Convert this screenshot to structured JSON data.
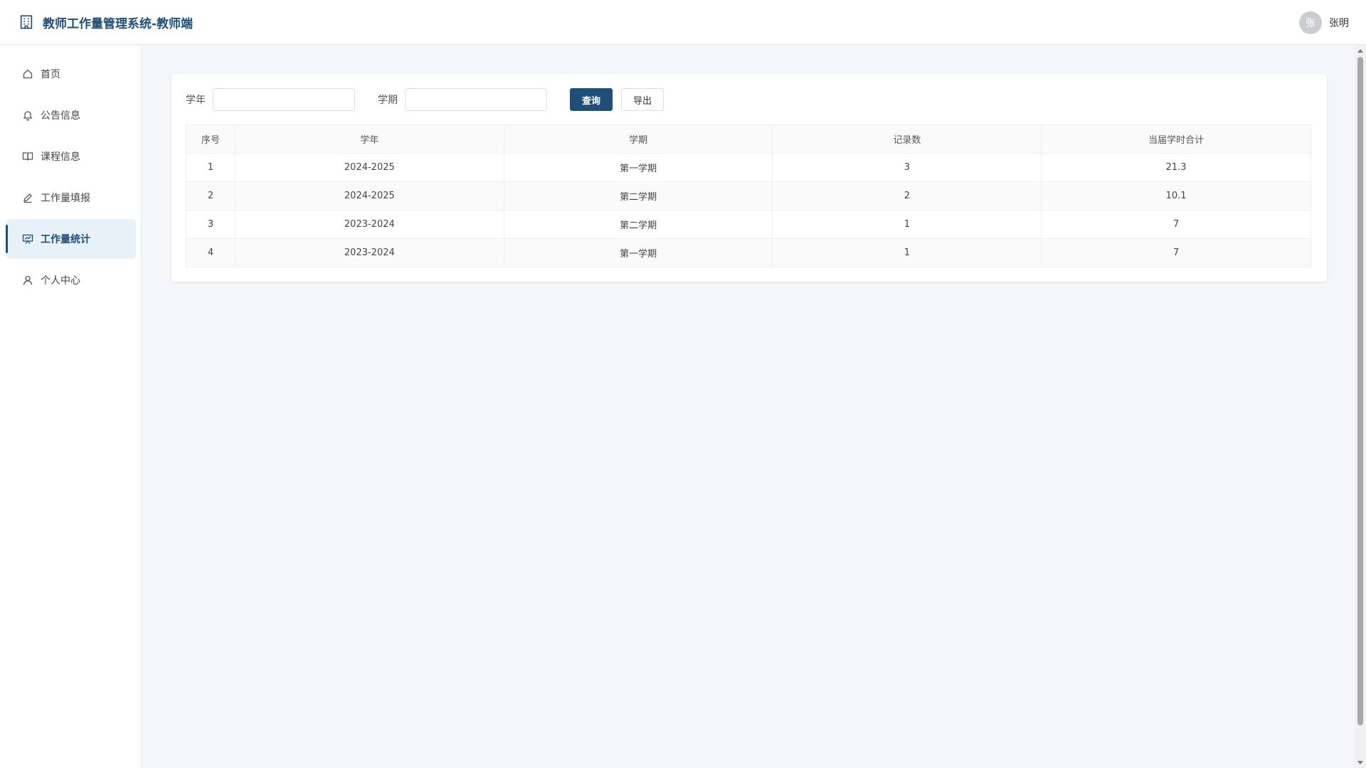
{
  "header": {
    "title": "教师工作量管理系统-教师端",
    "avatar_initial": "张",
    "username": "张明"
  },
  "sidebar": {
    "items": [
      {
        "label": "首页",
        "icon": "home-icon"
      },
      {
        "label": "公告信息",
        "icon": "bell-icon"
      },
      {
        "label": "课程信息",
        "icon": "book-icon"
      },
      {
        "label": "工作量填报",
        "icon": "edit-icon"
      },
      {
        "label": "工作量统计",
        "icon": "chart-board-icon",
        "active": true
      },
      {
        "label": "个人中心",
        "icon": "user-icon"
      }
    ]
  },
  "filters": {
    "year_label": "学年",
    "year_value": "",
    "term_label": "学期",
    "term_value": "",
    "query_label": "查询",
    "export_label": "导出"
  },
  "table": {
    "headers": [
      "序号",
      "学年",
      "学期",
      "记录数",
      "当届学时合计"
    ],
    "rows": [
      [
        "1",
        "2024-2025",
        "第一学期",
        "3",
        "21.3"
      ],
      [
        "2",
        "2024-2025",
        "第二学期",
        "2",
        "10.1"
      ],
      [
        "3",
        "2023-2024",
        "第二学期",
        "1",
        "7"
      ],
      [
        "4",
        "2023-2024",
        "第一学期",
        "1",
        "7"
      ]
    ]
  },
  "colors": {
    "primary": "#1f4e79",
    "active_bg": "#e8f0f8"
  }
}
